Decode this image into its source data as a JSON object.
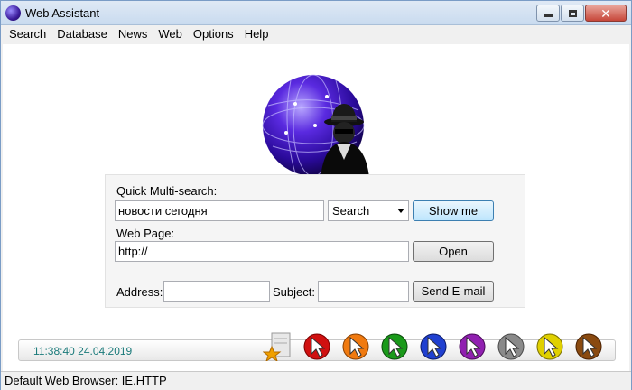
{
  "window": {
    "title": "Web Assistant"
  },
  "menu": [
    "Search",
    "Database",
    "News",
    "Web",
    "Options",
    "Help"
  ],
  "quick_search": {
    "label": "Quick Multi-search:",
    "value": "новости сегодня",
    "engine": "Search",
    "button": "Show me"
  },
  "web_page": {
    "label": "Web Page:",
    "value": "http://",
    "button": "Open"
  },
  "email": {
    "address_label": "Address:",
    "address_value": "",
    "subject_label": "Subject:",
    "subject_value": "",
    "button": "Send E-mail"
  },
  "clock": "11:38:40 24.04.2019",
  "toolbar_icons": [
    {
      "name": "favorites-icon",
      "color": "#f0a000"
    },
    {
      "name": "red-cursor-icon",
      "color": "#d01010"
    },
    {
      "name": "orange-cursor-icon",
      "color": "#f07a10"
    },
    {
      "name": "green-cursor-icon",
      "color": "#1a9a1a"
    },
    {
      "name": "blue-cursor-icon",
      "color": "#2040d0"
    },
    {
      "name": "purple-cursor-icon",
      "color": "#9020b0"
    },
    {
      "name": "gray-cursor-icon",
      "color": "#8a8a8a"
    },
    {
      "name": "yellow-cursor-icon",
      "color": "#e0d000"
    },
    {
      "name": "brown-cursor-icon",
      "color": "#8a4a10"
    }
  ],
  "status": "Default Web Browser: IE.HTTP"
}
